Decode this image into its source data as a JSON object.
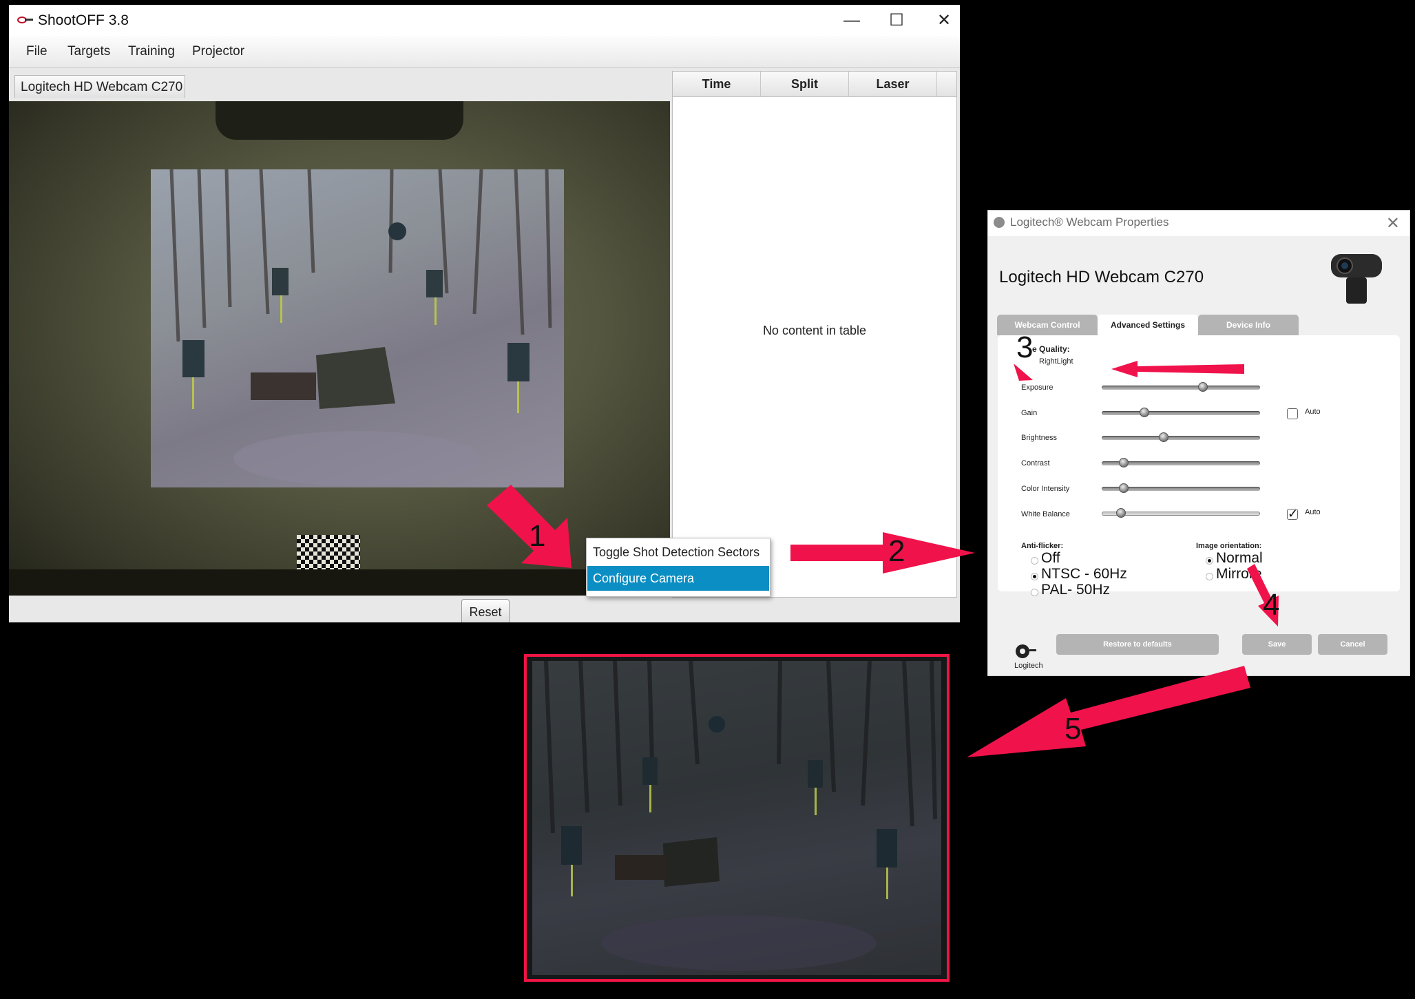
{
  "shootoff": {
    "title": "ShootOFF 3.8",
    "window_controls": {
      "minimize": "—",
      "maximize": "☐",
      "close": "✕"
    },
    "menu": [
      "File",
      "Targets",
      "Training",
      "Projector"
    ],
    "camera_tab": "Logitech HD Webcam C270 1",
    "table": {
      "columns": [
        "Time",
        "Split",
        "Laser"
      ],
      "empty_text": "No content in table"
    },
    "reset_label": "Reset",
    "context_menu": {
      "items": [
        "Toggle Shot Detection Sectors",
        "Configure Camera"
      ],
      "selected": "Configure Camera"
    }
  },
  "logitech": {
    "title": "Logitech® Webcam Properties",
    "close": "✕",
    "heading": "Logitech HD Webcam C270",
    "tabs": [
      "Webcam Control",
      "Advanced Settings",
      "Device Info"
    ],
    "active_tab": "Advanced Settings",
    "image_quality_label": "e Quality:",
    "rightlight_label": "RightLight",
    "sliders": [
      {
        "label": "Exposure",
        "value": 0.64
      },
      {
        "label": "Gain",
        "value": 0.27
      },
      {
        "label": "Brightness",
        "value": 0.39
      },
      {
        "label": "Contrast",
        "value": 0.14
      },
      {
        "label": "Color Intensity",
        "value": 0.14
      },
      {
        "label": "White Balance",
        "value": 0.12
      }
    ],
    "gain_auto": {
      "label": "Auto",
      "checked": false
    },
    "white_balance_auto": {
      "label": "Auto",
      "checked": true,
      "mark": "✓"
    },
    "anti_flicker": {
      "label": "Anti-flicker:",
      "options": [
        "Off",
        "NTSC - 60Hz",
        "PAL- 50Hz"
      ],
      "selected": "NTSC - 60Hz"
    },
    "image_orientation": {
      "label": "Image orientation:",
      "options": [
        "Normal",
        "Mirrore"
      ],
      "selected": "Normal"
    },
    "brand": "Logitech",
    "buttons": {
      "restore": "Restore to defaults",
      "save": "Save",
      "cancel": "Cancel"
    }
  },
  "annotations": {
    "steps": [
      "1",
      "2",
      "3",
      "4",
      "5"
    ],
    "arrow_color": "#f0124a"
  }
}
